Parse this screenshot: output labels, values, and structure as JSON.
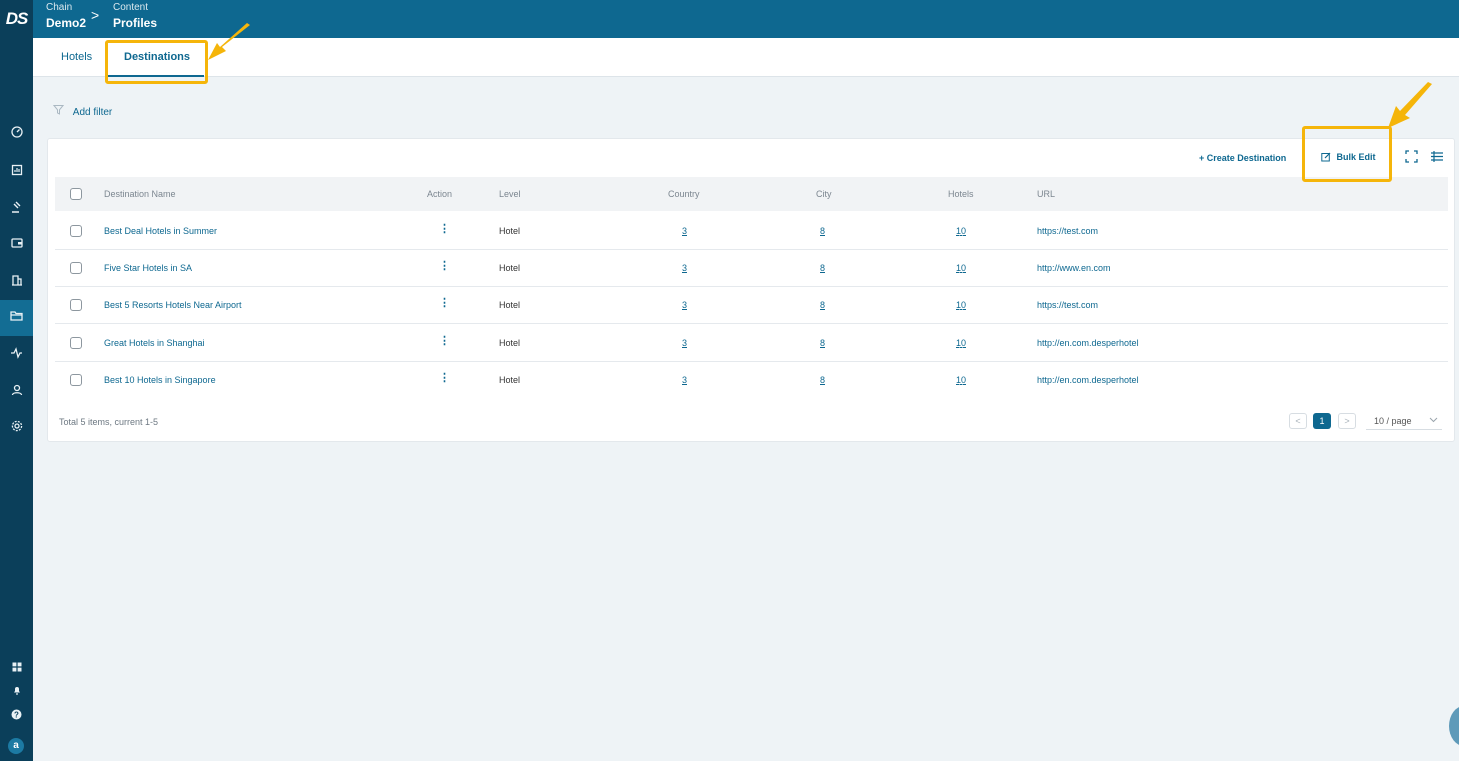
{
  "header": {
    "logo": "DS",
    "crumbs": [
      {
        "label": "Chain",
        "value": "Demo2"
      },
      {
        "label": "Content",
        "value": "Profiles"
      }
    ],
    "separator": ">"
  },
  "sidebar": {
    "items": [
      {
        "icon": "dashboard-icon"
      },
      {
        "icon": "report-icon"
      },
      {
        "icon": "gavel-icon"
      },
      {
        "icon": "wallet-icon"
      },
      {
        "icon": "building-icon"
      },
      {
        "icon": "folder-icon"
      },
      {
        "icon": "activity-icon"
      },
      {
        "icon": "user-icon"
      },
      {
        "icon": "settings-icon"
      }
    ],
    "bottom": [
      {
        "icon": "grid-icon"
      },
      {
        "icon": "bell-icon"
      },
      {
        "icon": "help-icon"
      }
    ],
    "avatar": "a"
  },
  "tabs": [
    {
      "label": "Hotels"
    },
    {
      "label": "Destinations"
    }
  ],
  "filter": {
    "label": "Add filter"
  },
  "toolbar": {
    "create_label": "+ Create Destination",
    "bulk_edit_label": "Bulk Edit"
  },
  "table": {
    "columns": [
      "Destination Name",
      "Action",
      "Level",
      "Country",
      "City",
      "Hotels",
      "URL"
    ],
    "rows": [
      {
        "name": "Best Deal Hotels in Summer",
        "level": "Hotel",
        "country": "3",
        "city": "8",
        "hotels": "10",
        "url": "https://test.com"
      },
      {
        "name": "Five Star Hotels in SA",
        "level": "Hotel",
        "country": "3",
        "city": "8",
        "hotels": "10",
        "url": "http://www.en.com"
      },
      {
        "name": "Best 5 Resorts Hotels Near Airport",
        "level": "Hotel",
        "country": "3",
        "city": "8",
        "hotels": "10",
        "url": "https://test.com"
      },
      {
        "name": "Great Hotels in Shanghai",
        "level": "Hotel",
        "country": "3",
        "city": "8",
        "hotels": "10",
        "url": "http://en.com.desperhotel"
      },
      {
        "name": "Best 10 Hotels in Singapore",
        "level": "Hotel",
        "country": "3",
        "city": "8",
        "hotels": "10",
        "url": "http://en.com.desperhotel"
      }
    ]
  },
  "footer": {
    "total": "Total 5 items, current 1-5",
    "current_page": "1",
    "page_size": "10 / page"
  },
  "colors": {
    "brand": "#0e6890",
    "sidebar": "#0b3f5a",
    "highlight": "#f5b50a"
  }
}
